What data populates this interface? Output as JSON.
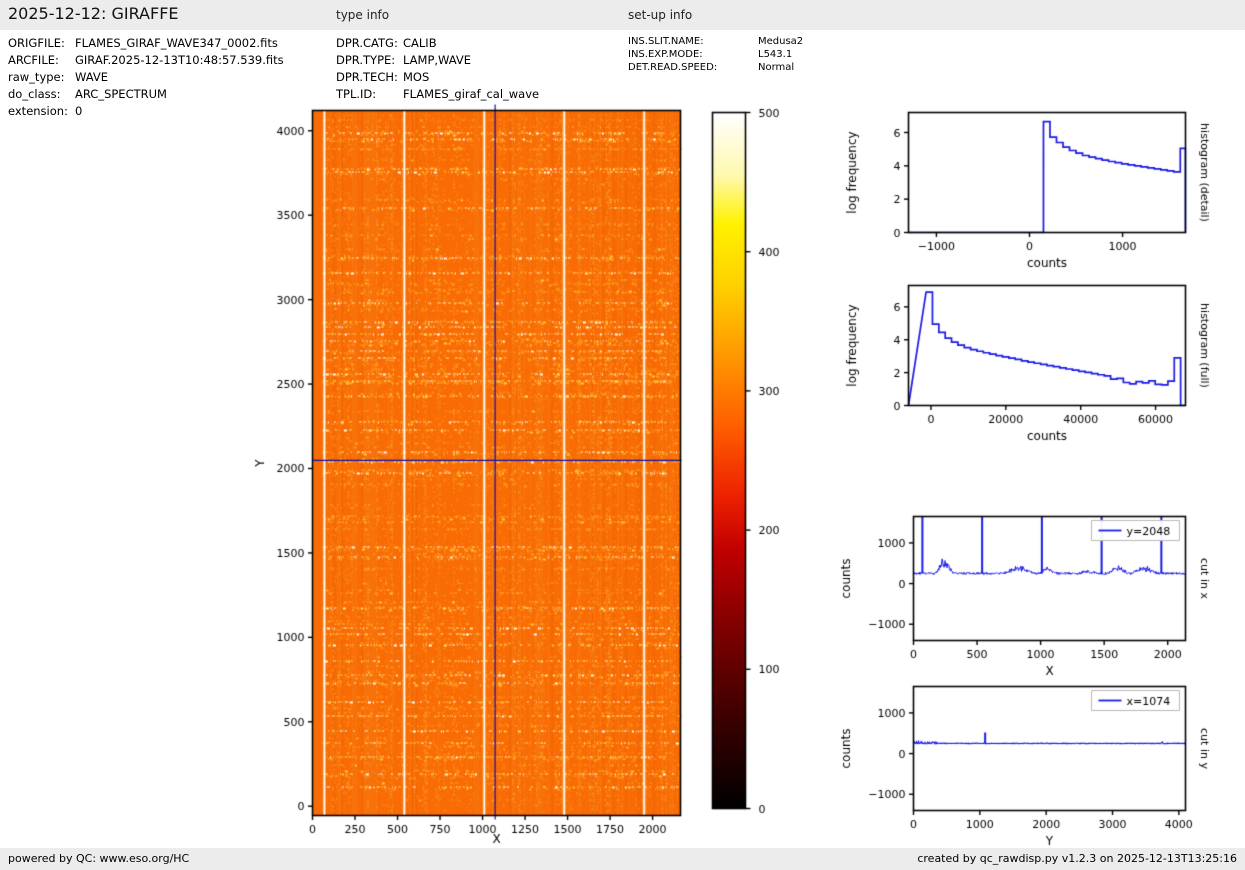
{
  "page": {
    "title": "2025-12-12: GIRAFFE",
    "section_type_info": "type info",
    "section_setup_info": "set-up info",
    "footer_left": "powered by QC: www.eso.org/HC",
    "footer_right": "created by qc_rawdisp.py v1.2.3 on 2025-12-13T13:25:16"
  },
  "file_info": {
    "rows": [
      {
        "label": "ORIGFILE:",
        "value": "FLAMES_GIRAF_WAVE347_0002.fits"
      },
      {
        "label": "ARCFILE:",
        "value": "GIRAF.2025-12-13T10:48:57.539.fits"
      },
      {
        "label": "raw_type:",
        "value": "WAVE"
      },
      {
        "label": "do_class:",
        "value": "ARC_SPECTRUM"
      },
      {
        "label": "extension:",
        "value": "0"
      }
    ]
  },
  "type_info": {
    "rows": [
      {
        "label": "DPR.CATG:",
        "value": "CALIB"
      },
      {
        "label": "DPR.TYPE:",
        "value": "LAMP,WAVE"
      },
      {
        "label": "DPR.TECH:",
        "value": "MOS"
      },
      {
        "label": "TPL.ID:",
        "value": "FLAMES_giraf_cal_wave"
      }
    ]
  },
  "setup_info": {
    "rows": [
      {
        "label": "INS.SLIT.NAME:",
        "value": "Medusa2"
      },
      {
        "label": "INS.EXP.MODE:",
        "value": "L543.1"
      },
      {
        "label": "DET.READ.SPEED:",
        "value": "Normal"
      }
    ]
  },
  "colors": {
    "plot_line_blue": "#1a1ae6",
    "crosshair_blue": "#1111aa",
    "image_base_orange": "#f96b04",
    "bar_gray": "#ececec"
  },
  "chart_data": [
    {
      "name": "raw_frame_image",
      "type": "heatmap",
      "xlabel": "X",
      "ylabel": "Y",
      "x_range": [
        0,
        2164
      ],
      "y_range": [
        -55,
        4120
      ],
      "x_ticks": [
        0,
        250,
        500,
        750,
        1000,
        1250,
        1500,
        1750,
        2000
      ],
      "y_ticks": [
        0,
        500,
        1000,
        1500,
        2000,
        2500,
        3000,
        3500,
        4000
      ],
      "colormap": "hot",
      "base_value_approx": 250,
      "prescan_margin_x": [
        0,
        55
      ],
      "simcal_fiber_columns_x": [
        70,
        540,
        1010,
        1480,
        1950
      ],
      "crosshair": {
        "x": 1074,
        "y": 2048
      },
      "bright_rows_y": [
        115,
        195,
        295,
        375,
        450,
        540,
        620,
        735,
        780,
        860,
        955,
        1020,
        1060,
        1175,
        1480,
        1540,
        1975,
        2040,
        2100,
        2230,
        2280,
        2430,
        2520,
        2560,
        2655,
        2700,
        2755,
        2800,
        2840,
        2870,
        2985,
        3160,
        3250,
        3545,
        3760,
        3775,
        3955,
        3990
      ]
    },
    {
      "name": "colorbar",
      "type": "colorbar",
      "min": 0,
      "max": 500,
      "ticks": [
        0,
        100,
        200,
        300,
        400,
        500
      ],
      "colormap": "hot"
    },
    {
      "name": "histogram_detail",
      "type": "step-histogram",
      "xlabel": "counts",
      "ylabel": "log frequency",
      "side_label": "histogram (detail)",
      "x_range": [
        -1300,
        1676
      ],
      "y_range": [
        0,
        7.2
      ],
      "x_ticks": [
        -1000,
        0,
        1000
      ],
      "y_ticks": [
        0,
        2,
        4,
        6
      ],
      "bin_edges": [
        -1300,
        150,
        220,
        290,
        360,
        430,
        500,
        570,
        640,
        710,
        780,
        850,
        920,
        990,
        1060,
        1130,
        1200,
        1270,
        1340,
        1410,
        1480,
        1550,
        1620,
        1676
      ],
      "log_frequency": [
        0,
        6.65,
        5.72,
        5.4,
        5.12,
        4.92,
        4.76,
        4.62,
        4.52,
        4.43,
        4.34,
        4.26,
        4.19,
        4.12,
        4.06,
        4.0,
        3.94,
        3.88,
        3.82,
        3.76,
        3.7,
        3.64,
        5.05
      ]
    },
    {
      "name": "histogram_full",
      "type": "step-histogram",
      "xlabel": "counts",
      "ylabel": "log frequency",
      "side_label": "histogram (full)",
      "x_range": [
        -6000,
        68000
      ],
      "y_range": [
        0,
        7.3
      ],
      "x_ticks": [
        0,
        20000,
        40000,
        60000
      ],
      "y_ticks": [
        0,
        2,
        4,
        6
      ],
      "bin_edges": [
        -1300,
        400,
        2100,
        3800,
        5500,
        7200,
        8900,
        10600,
        12300,
        14000,
        15700,
        17400,
        19100,
        20800,
        22500,
        24200,
        25900,
        27600,
        29300,
        31000,
        32700,
        34400,
        36100,
        37800,
        39500,
        41200,
        42900,
        44600,
        46300,
        48000,
        49700,
        51400,
        53100,
        54800,
        56500,
        58200,
        59900,
        61600,
        63300,
        65000,
        66700
      ],
      "log_frequency": [
        6.9,
        4.95,
        4.45,
        4.1,
        3.85,
        3.67,
        3.52,
        3.4,
        3.3,
        3.21,
        3.12,
        3.04,
        2.96,
        2.88,
        2.8,
        2.72,
        2.64,
        2.57,
        2.5,
        2.43,
        2.36,
        2.29,
        2.22,
        2.15,
        2.08,
        2.01,
        1.94,
        1.87,
        1.8,
        1.6,
        1.65,
        1.4,
        1.32,
        1.45,
        1.38,
        1.5,
        1.28,
        1.25,
        1.48,
        2.9
      ]
    },
    {
      "name": "cut_in_x",
      "type": "line",
      "legend": "y=2048",
      "xlabel": "X",
      "ylabel": "counts",
      "side_label": "cut in x",
      "x_range": [
        0,
        2140
      ],
      "y_range": [
        -1400,
        1650
      ],
      "x_ticks": [
        0,
        500,
        1000,
        1500,
        2000
      ],
      "y_ticks": [
        -1000,
        0,
        1000
      ],
      "baseline_counts": 250,
      "spike_columns_x": [
        70,
        540,
        1010,
        1480,
        1950
      ],
      "bumps": [
        {
          "x0": 170,
          "x1": 315,
          "peak_counts": 650
        },
        {
          "x0": 700,
          "x1": 960,
          "peak_counts": 430
        },
        {
          "x0": 975,
          "x1": 1130,
          "peak_counts": 390
        },
        {
          "x0": 1290,
          "x1": 1460,
          "peak_counts": 320
        },
        {
          "x0": 1530,
          "x1": 1690,
          "peak_counts": 440
        },
        {
          "x0": 1705,
          "x1": 1925,
          "peak_counts": 430
        }
      ]
    },
    {
      "name": "cut_in_y",
      "type": "line",
      "legend": "x=1074",
      "xlabel": "Y",
      "ylabel": "counts",
      "side_label": "cut in y",
      "x_range": [
        0,
        4100
      ],
      "y_range": [
        -1400,
        1650
      ],
      "x_ticks": [
        0,
        1000,
        2000,
        3000,
        4000
      ],
      "y_ticks": [
        -1000,
        0,
        1000
      ],
      "baseline_counts": 250,
      "spike": {
        "y": 1080,
        "peak_counts": 520
      },
      "noisy_region": {
        "y0": 0,
        "y1": 350,
        "amplitude_counts": 60
      }
    }
  ]
}
